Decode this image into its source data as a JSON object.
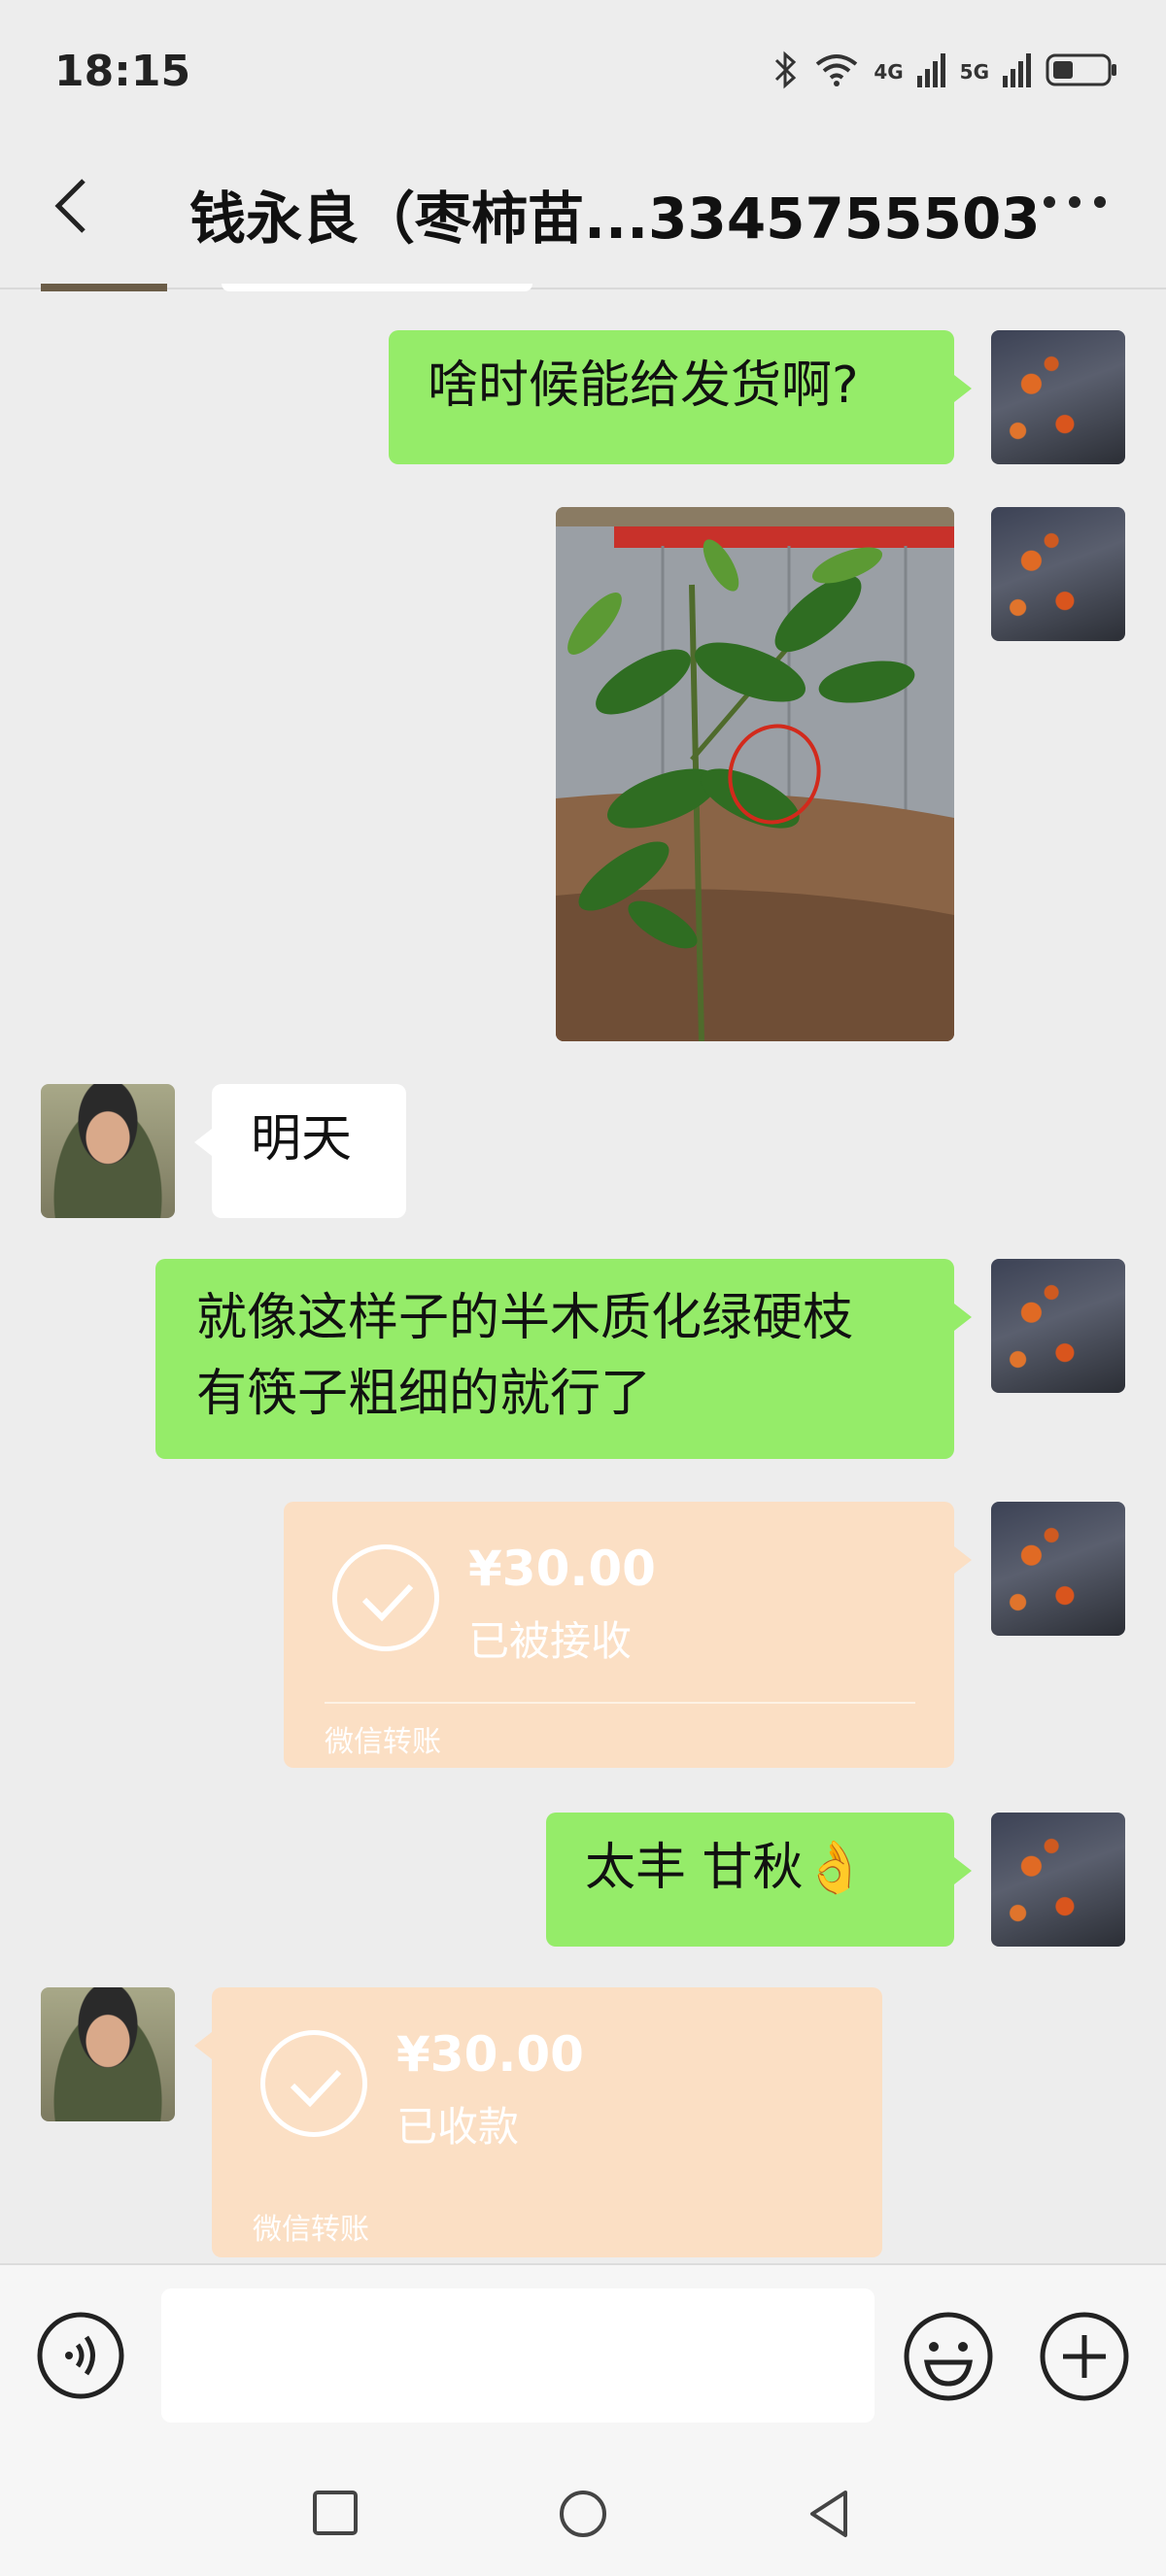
{
  "status_bar": {
    "time": "18:15",
    "network_1": "4G",
    "network_2": "5G"
  },
  "header": {
    "title": "钱永良（枣柿苗...3345755503"
  },
  "messages": {
    "m1": "啥时候能给发货啊?",
    "m2": "明天",
    "m3_line1": "就像这样子的半木质化绿硬枝",
    "m3_line2": "有筷子粗细的就行了",
    "m4": "太丰  甘秋👌",
    "transfer_sent": {
      "amount": "¥30.00",
      "status": "已被接收",
      "label": "微信转账"
    },
    "transfer_received": {
      "amount": "¥30.00",
      "status": "已收款",
      "label": "微信转账"
    }
  },
  "input": {
    "value": ""
  }
}
